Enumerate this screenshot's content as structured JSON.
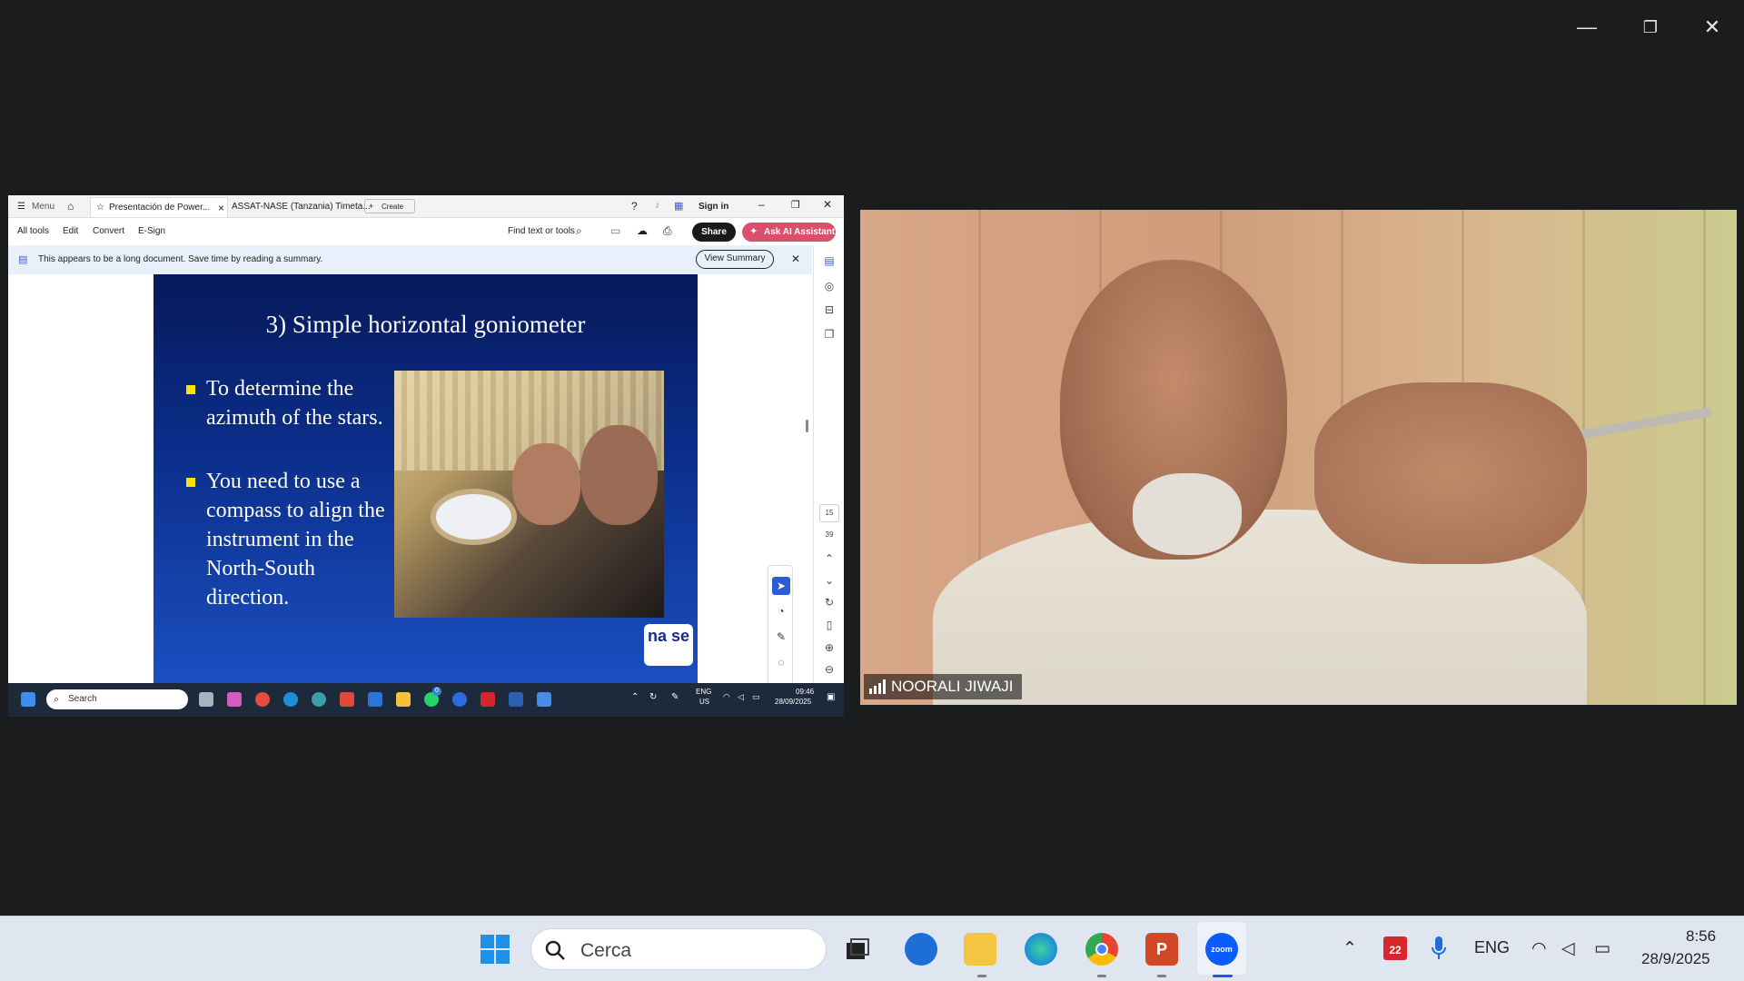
{
  "zoom_window": {
    "controls": {
      "minimize": "—",
      "restore": "❐",
      "close": "✕"
    }
  },
  "acrobat": {
    "menu_label": "Menu",
    "tabs": [
      {
        "label": "Presentación de Power...",
        "close": "×"
      },
      {
        "label": "ASSAT-NASE (Tanzania) Timeta..."
      }
    ],
    "create_label": "Create",
    "sign_in": "Sign in",
    "toolbar": {
      "all_tools": "All tools",
      "edit": "Edit",
      "convert": "Convert",
      "esign": "E-Sign",
      "find": "Find text or tools",
      "share": "Share",
      "ask_ai": "Ask AI Assistant"
    },
    "banner": {
      "text": "This appears to be a long document. Save time by reading a summary.",
      "button": "View Summary",
      "close": "✕"
    },
    "page_nav": {
      "current": "15",
      "total": "39"
    }
  },
  "slide": {
    "title": "3) Simple horizontal goniometer",
    "bullets": [
      "To determine the azimuth of the stars.",
      "You need to use a compass to align the instrument in the North-South direction."
    ],
    "logo_text": "na se"
  },
  "inner_taskbar": {
    "search_placeholder": "Search",
    "lang": "ENG",
    "region": "US",
    "time": "09:46",
    "date": "28/09/2025",
    "whatsapp_badge": "0"
  },
  "participant": {
    "name": "NOORALI JIWAJI"
  },
  "taskbar": {
    "search_placeholder": "Cerca",
    "zoom_label": "zoom",
    "calendar_badge": "22",
    "lang": "ENG",
    "time": "8:56",
    "date": "28/9/2025"
  },
  "colors": {
    "share_blue": "#1a1a1a",
    "ai_pink": "#d9506b",
    "slide_bg": "#0c2f8c",
    "bullet": "#ffe000",
    "zoom_blue": "#0b5cff"
  }
}
